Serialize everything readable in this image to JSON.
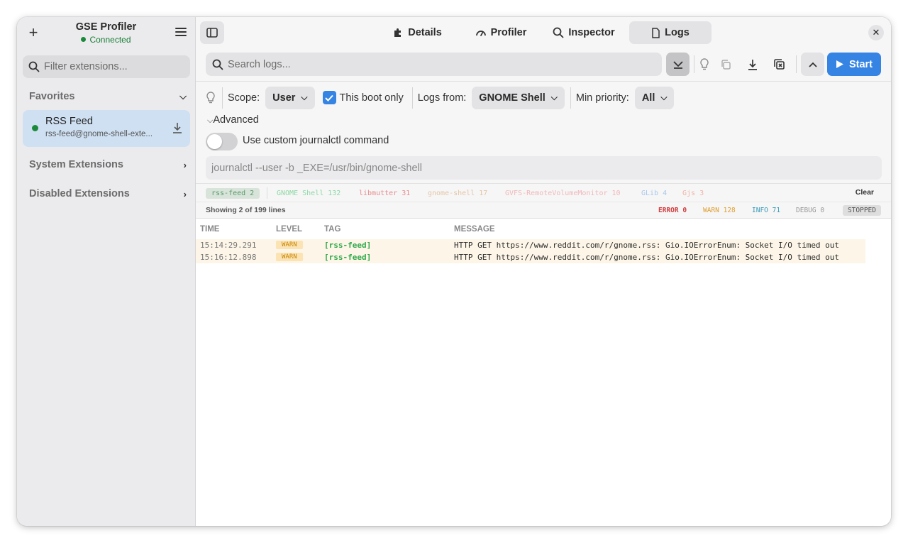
{
  "sidebar": {
    "title": "GSE Profiler",
    "status": "Connected",
    "filter_placeholder": "Filter extensions...",
    "favorites_label": "Favorites",
    "favorite_item": {
      "name": "RSS Feed",
      "uuid": "rss-feed@gnome-shell-exte..."
    },
    "system_label": "System Extensions",
    "disabled_label": "Disabled Extensions"
  },
  "tabs": [
    {
      "label": "Details",
      "icon": "puzzle-icon"
    },
    {
      "label": "Profiler",
      "icon": "gauge-icon"
    },
    {
      "label": "Inspector",
      "icon": "search-icon"
    },
    {
      "label": "Logs",
      "icon": "document-icon",
      "active": true
    }
  ],
  "toolbar": {
    "search_placeholder": "Search logs...",
    "start_label": "Start"
  },
  "filters": {
    "scope_label": "Scope:",
    "scope_value": "User",
    "boot_label": "This boot only",
    "boot_checked": true,
    "logs_from_label": "Logs from:",
    "logs_from_value": "GNOME Shell",
    "priority_label": "Min priority:",
    "priority_value": "All",
    "advanced_label": "Advanced",
    "custom_label": "Use custom journalctl command",
    "command_placeholder": "journalctl --user -b _EXE=/usr/bin/gnome-shell"
  },
  "tag_chips": [
    {
      "label": "rss-feed 2",
      "color": "#5a9a6a",
      "bg": "#d8e4da",
      "active": true
    },
    {
      "label": "GNOME Shell 132",
      "color": "#8fd8a4"
    },
    {
      "label": "libmutter 31",
      "color": "#e88c8c"
    },
    {
      "label": "gnome-shell 17",
      "color": "#e5c5a4"
    },
    {
      "label": "GVFS-RemoteVolumeMonitor 10",
      "color": "#f0b8b8"
    },
    {
      "label": "GLib 4",
      "color": "#a8c8e8"
    },
    {
      "label": "Gjs 3",
      "color": "#f0b4a4"
    }
  ],
  "clear_label": "Clear",
  "status": {
    "showing": "Showing 2 of 199 lines",
    "error": "ERROR 0",
    "warn": "WARN 128",
    "info": "INFO 71",
    "debug": "DEBUG 0",
    "state": "STOPPED"
  },
  "log_columns": [
    "TIME",
    "LEVEL",
    "TAG",
    "MESSAGE"
  ],
  "log_rows": [
    {
      "time": "15:14:29.291",
      "level": "WARN",
      "tag": "[rss-feed]",
      "message": "HTTP GET https://www.reddit.com/r/gnome.rss: Gio.IOErrorEnum: Socket I/O timed out"
    },
    {
      "time": "15:16:12.898",
      "level": "WARN",
      "tag": "[rss-feed]",
      "message": "HTTP GET https://www.reddit.com/r/gnome.rss: Gio.IOErrorEnum: Socket I/O timed out"
    }
  ],
  "colors": {
    "accent": "#3584e4",
    "connected": "#1a8a3a",
    "error": "#d04040",
    "warn": "#e0a030",
    "info": "#3a9ab8",
    "debug": "#999999",
    "tag_green": "#2ea84a"
  }
}
